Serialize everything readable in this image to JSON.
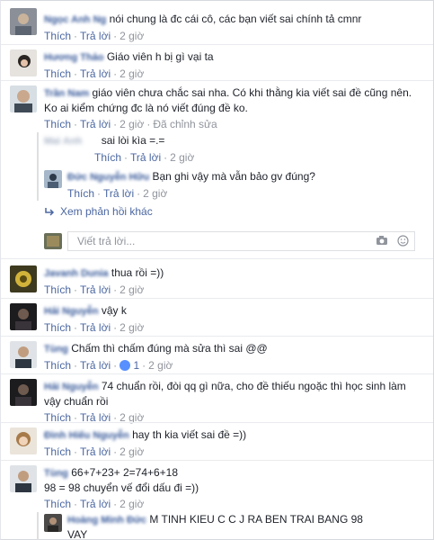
{
  "comments": [
    {
      "name": "Ngọc Anh Ng",
      "text": "nói chung là   đc cái cô, các bạn viết sai chính tả cmnr",
      "like": "Thích",
      "reply": "Trả lời",
      "time": "2 giờ"
    },
    {
      "name": "Hương Thảo",
      "text": "Giáo viên h bị gì vại ta",
      "like": "Thích",
      "reply": "Trả lời",
      "time": "2 giờ"
    },
    {
      "name": "Trần Nam",
      "text_line1": "giáo viên chưa chắc sai nha. Có khi thằng kia viết sai đề cũng nên.",
      "text_line2": "Ko ai kiểm chứng đc là nó viết đúng đề ko.",
      "like": "Thích",
      "reply": "Trả lời",
      "time": "2 giờ",
      "edited": "Đã chỉnh sửa"
    },
    {
      "name": "Đức Nguyễn Hữu",
      "text": "Bạn ghi vậy mà vẫn bảo gv đúng?",
      "like": "Thích",
      "reply": "Trả lời",
      "time": "2 giờ"
    },
    {
      "name": "Javanh Dunia",
      "text": "thua rồi =))",
      "like": "Thích",
      "reply": "Trả lời",
      "time": "2 giờ"
    },
    {
      "name": "Hải Nguyễn",
      "text": "vậy k",
      "like": "Thích",
      "reply": "Trả lời",
      "time": "2 giờ"
    },
    {
      "name": "Tùng",
      "text": "Chấm thì chấm đúng mà sửa thì sai @@",
      "like": "Thích",
      "reply": "Trả lời",
      "likes_count": "1",
      "time": "2 giờ"
    },
    {
      "name": "Hải Nguyễn",
      "text_line1": "74 chuẩn rồi, đòi qq gì nữa, cho đề thiếu ngoặc thì học sinh làm",
      "text_line2": "vậy chuẩn rồi",
      "like": "Thích",
      "reply": "Trả lời",
      "time": "2 giờ"
    },
    {
      "name": "Đình Hiếu Nguyễn",
      "text": "hay th   kia viết sai đề =))",
      "like": "Thích",
      "reply": "Trả lời",
      "time": "2 giờ"
    },
    {
      "name": "Tùng",
      "text_line1": "66+7+23+ 2=74+6+18",
      "text_line2": "98 = 98 chuyển vế đổi dấu đi =))",
      "like": "Thích",
      "reply": "Trả lời",
      "time": "2 giờ"
    }
  ],
  "nested_reply_1": {
    "name": "Mai Anh",
    "text": "sai lòi kìa =.=",
    "like": "Thích",
    "reply": "Trả lời",
    "time": "2 giờ"
  },
  "nested_reply_last": {
    "name": "Hoàng Minh Đức",
    "text_line1": "M TINH KIEU C       C J RA BEN TRAI BANG 98",
    "text_line2": "VAY"
  },
  "more_replies": "Xem phản hồi khác",
  "reply_input": {
    "placeholder": "Viết trả lời..."
  },
  "colors": {
    "link": "#4b67a1",
    "name": "#365899",
    "muted": "#90949c",
    "like": "#5890ff"
  },
  "icons": {
    "more_replies": "reply-arrow-icon",
    "camera": "camera-icon",
    "emoji": "emoji-icon",
    "like": "like-icon"
  }
}
